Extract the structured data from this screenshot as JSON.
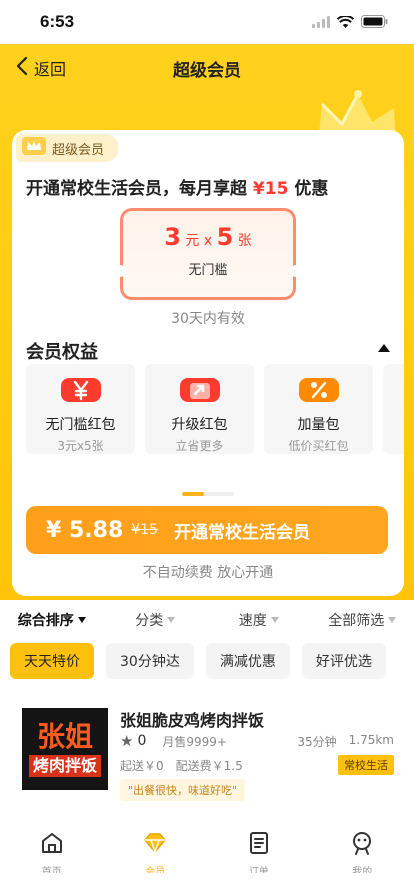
{
  "status_bar": {
    "time": "6:53"
  },
  "nav": {
    "back_label": "返回",
    "title": "超级会员"
  },
  "colors": {
    "brand_yellow": "#ffcc10",
    "cta_orange": "#ffa11a",
    "price_red": "#ff3b2f"
  },
  "membership": {
    "tag_label": "超级会员",
    "headline_prefix": "开通常校生活会员，每月享超",
    "headline_amount": "¥15",
    "headline_suffix": "优惠",
    "coupon": {
      "amount": "3",
      "unit": "元",
      "times_sign": "x",
      "count": "5",
      "count_unit": "张",
      "condition": "无门槛"
    },
    "validity": "30天内有效"
  },
  "benefits": {
    "title": "会员权益",
    "items": [
      {
        "name": "无门槛红包",
        "desc": "3元x5张",
        "icon": "yen-icon",
        "color": "#ff3b30"
      },
      {
        "name": "升级红包",
        "desc": "立省更多",
        "icon": "upgrade-arrow-icon",
        "color": "#ff3b30"
      },
      {
        "name": "加量包",
        "desc": "低价买红包",
        "icon": "percent-icon",
        "color": "#ff8a00"
      }
    ],
    "carousel": {
      "page": 1,
      "pages": 2
    }
  },
  "cta": {
    "price": "¥ 5.88",
    "original_price": "¥15",
    "label": "开通常校生活会员",
    "note": "不自动续费 放心开通"
  },
  "sort_bar": {
    "items": [
      {
        "label": "综合排序",
        "active": true
      },
      {
        "label": "分类",
        "active": false
      },
      {
        "label": "速度",
        "active": false
      },
      {
        "label": "全部筛选",
        "active": false
      }
    ]
  },
  "chips": [
    {
      "label": "天天特价",
      "active": true
    },
    {
      "label": "30分钟达",
      "active": false
    },
    {
      "label": "满减优惠",
      "active": false
    },
    {
      "label": "好评优选",
      "active": false
    }
  ],
  "store": {
    "logo_text_top": "张姐",
    "logo_text_bottom": "烤肉拌饭",
    "name": "张姐脆皮鸡烤肉拌饭",
    "rating": "0",
    "monthly_sales": "月售9999+",
    "delivery_time": "35分钟",
    "distance": "1.75km",
    "min_order": "起送￥0",
    "delivery_fee": "配送费￥1.5",
    "tag": "常校生活",
    "quote": "\"出餐很快，味道好吃\""
  },
  "tabbar": {
    "items": [
      {
        "label": "首页",
        "icon": "home-icon",
        "active": false
      },
      {
        "label": "会员",
        "icon": "diamond-icon",
        "active": true
      },
      {
        "label": "订单",
        "icon": "order-list-icon",
        "active": false
      },
      {
        "label": "我的",
        "icon": "profile-icon",
        "active": false
      }
    ]
  }
}
